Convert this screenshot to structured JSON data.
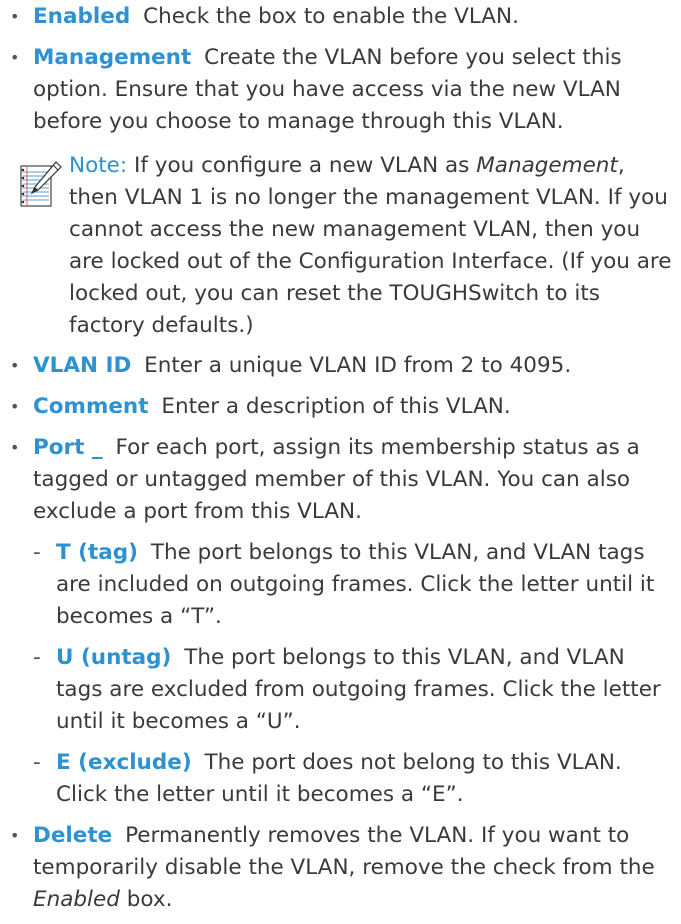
{
  "items": [
    {
      "term": "Enabled",
      "text": "Check the box to enable the VLAN."
    },
    {
      "term": "Management",
      "text": "Create the VLAN before you select this option. Ensure that you have access via the new VLAN before you choose to manage through this VLAN."
    },
    {
      "term": "VLAN ID",
      "text": "Enter a unique VLAN ID from 2 to 4095."
    },
    {
      "term": "Comment",
      "text": "Enter a description of this VLAN."
    },
    {
      "term": "Port _",
      "text": "For each port, assign its membership status as a tagged or untagged member of this VLAN. You can also exclude a port from this VLAN."
    },
    {
      "term": "Delete",
      "text_before": "Permanently removes the VLAN. If you want to temporarily disable the VLAN, remove the check from the",
      "text_em": "Enabled",
      "text_after": "box."
    }
  ],
  "note": {
    "label": "Note:",
    "text_before": "If you configure a new VLAN as",
    "text_em": "Management",
    "text_after": ", then VLAN 1 is no longer the management VLAN. If you cannot access the new management VLAN, then you are locked out of the Configuration Interface. (If you are locked out, you can reset the TOUGHSwitch to its factory defaults.)",
    "icon": "note-pad-pencil-icon"
  },
  "port_options": [
    {
      "term": "T (tag)",
      "text": "The port belongs to this VLAN, and VLAN tags are included on outgoing frames. Click the letter until it becomes a “T”."
    },
    {
      "term": "U (untag)",
      "text": "The port belongs to this VLAN, and VLAN tags are excluded from outgoing frames. Click the letter until it becomes a “U”."
    },
    {
      "term": "E (exclude)",
      "text": "The port does not belong to this VLAN. Click the letter until it becomes a “E”."
    }
  ],
  "colors": {
    "term": "#2d91d2",
    "text": "#3a3a3a"
  }
}
